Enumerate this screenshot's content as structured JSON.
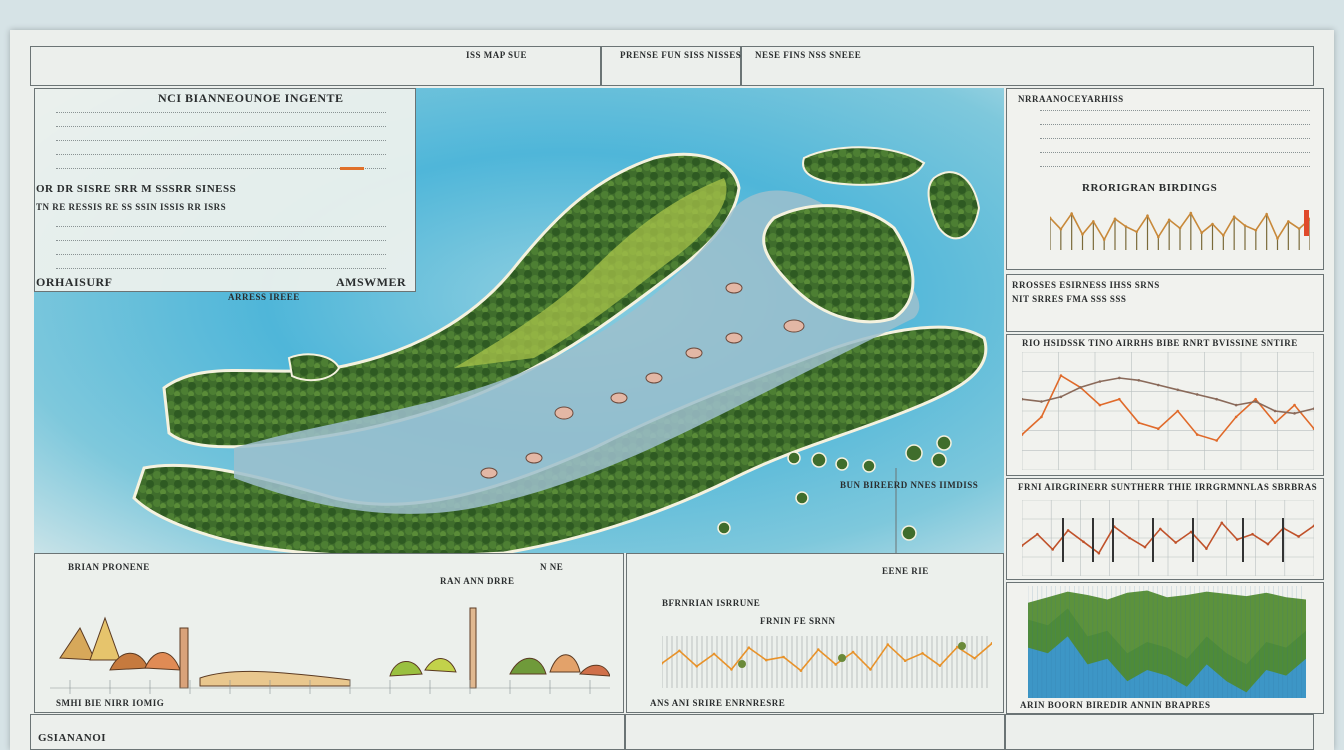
{
  "header": {
    "title_center": "ISS MAP SUE",
    "title_mid": "PRENSE FUN SISS NISSES",
    "title_right": "NESE FINS NSS SNEEE"
  },
  "legend_panel": {
    "heading": "NCI BIANNEOUNOE INGENTE",
    "line_1": "OR DR SISRE SRR M SSSRR SINESS",
    "line_2": "TN RE RESSIS RE SS SSIN ISSIS RR ISRS",
    "bottom_left": "ORHAISURF",
    "bottom_right": "AMSWMER",
    "footer": "ARRESS IREEE"
  },
  "right_top_panel": {
    "heading": "NRRAANOCEYARHISS",
    "subheading": "RRORIGRAN BIRDINGS"
  },
  "right_mid_panel": {
    "heading": "RROSSES ESIRNESS IHSS SRNS",
    "subheading": "NIT SRRES FMA SSS SSS"
  },
  "right_chart_1": {
    "title": "RIO HSIDSSK TINO AIRRHS BIBE RNRT BVISSINE SNTIRE"
  },
  "right_chart_2": {
    "title": "FRNI AIRGRINERR SUNTHERR THIE IRRGRMNNLAS SBRBRAS"
  },
  "right_bottom_panel": {
    "footer": "ARIN BOORN BIREDIR ANNIN BRAPRES"
  },
  "map": {
    "annotation": "BUN BIREERD NNES IIMDISS"
  },
  "bottom_left_panel": {
    "heading": "BRIAN PRONENE",
    "label_mid": "RAN ANN DRRE",
    "label_right": "N NE",
    "footer": "SMHI BIE NIRR IOMIG"
  },
  "bottom_mid_panel": {
    "heading": "BFRNRIAN ISRRUNE",
    "label_1": "FRNIN FE SRNN",
    "label_2": "EENE RIE",
    "footer": "ANS ANI SRIRE ENRNRESRE"
  },
  "bottom_left_footer": "GSIANANOI",
  "chart_data": [
    {
      "type": "line",
      "series": [
        {
          "values": [
            62,
            40,
            70,
            30,
            55,
            20,
            60,
            45,
            35,
            66,
            25,
            58,
            42,
            71,
            33,
            50,
            28,
            64,
            47,
            38,
            69,
            22,
            55,
            41,
            60
          ]
        }
      ],
      "ylim": [
        0,
        100
      ]
    },
    {
      "type": "line",
      "series": [
        {
          "values": [
            30,
            45,
            80,
            70,
            55,
            60,
            40,
            35,
            50,
            30,
            25,
            45,
            60,
            40,
            55,
            35
          ]
        },
        {
          "values": [
            60,
            58,
            62,
            70,
            75,
            78,
            76,
            72,
            68,
            64,
            60,
            55,
            58,
            50,
            48,
            52
          ]
        }
      ],
      "ylim": [
        0,
        100
      ]
    },
    {
      "type": "line",
      "series": [
        {
          "values": [
            40,
            55,
            35,
            60,
            45,
            30,
            65,
            50,
            38,
            62,
            44,
            58,
            36,
            70,
            48,
            55,
            42,
            63,
            52,
            66
          ]
        }
      ],
      "ylim": [
        0,
        100
      ]
    },
    {
      "type": "area",
      "series": [
        {
          "values": [
            70,
            65,
            80,
            55,
            60,
            40,
            50,
            45,
            35,
            55,
            40,
            30,
            50,
            45,
            60
          ]
        },
        {
          "values": [
            85,
            90,
            95,
            92,
            88,
            94,
            96,
            90,
            92,
            95,
            93,
            91,
            94,
            90,
            88
          ]
        }
      ],
      "ylim": [
        0,
        100
      ]
    }
  ]
}
